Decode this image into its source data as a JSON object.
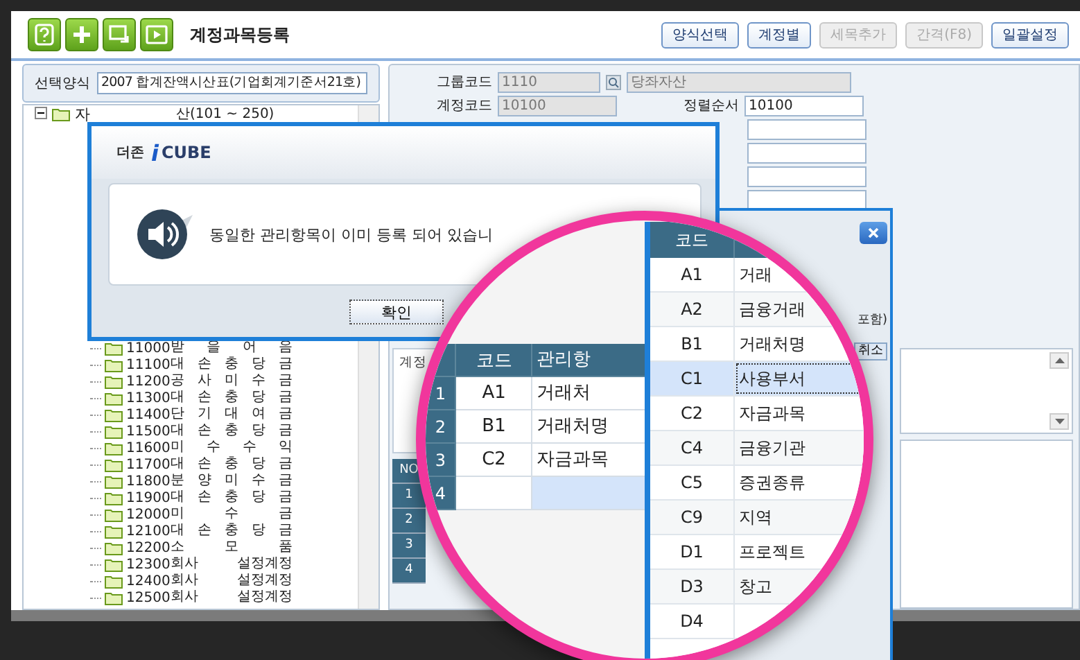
{
  "toolbar": {
    "title": "계정과목등록",
    "buttons": [
      {
        "label": "양식선택",
        "disabled": false
      },
      {
        "label": "계정별",
        "disabled": false
      },
      {
        "label": "세목추가",
        "disabled": true
      },
      {
        "label": "간격(F8)",
        "disabled": true
      },
      {
        "label": "일괄설정",
        "disabled": false
      }
    ]
  },
  "form_selector": {
    "label": "선택양식",
    "value": "2007 합계잔액시산표(기업회계기준서21호)"
  },
  "account_tree": {
    "code": "자",
    "name": "산(101 ~ 250)",
    "expanded": true,
    "children": [
      {
        "code": "11000",
        "name": "받 을 어 음"
      },
      {
        "code": "11100",
        "name": "대 손 충 당 금"
      },
      {
        "code": "11200",
        "name": "공 사 미 수 금"
      },
      {
        "code": "11300",
        "name": "대 손 충 당 금"
      },
      {
        "code": "11400",
        "name": "단 기 대 여 금"
      },
      {
        "code": "11500",
        "name": "대 손 충 당 금"
      },
      {
        "code": "11600",
        "name": "미 수 수 익"
      },
      {
        "code": "11700",
        "name": "대 손 충 당 금"
      },
      {
        "code": "11800",
        "name": "분 양 미 수 금"
      },
      {
        "code": "11900",
        "name": "대 손 충 당 금"
      },
      {
        "code": "12000",
        "name": "미 수 금"
      },
      {
        "code": "12100",
        "name": "대 손 충 당 금"
      },
      {
        "code": "12200",
        "name": "소 모 품"
      },
      {
        "code": "12300",
        "name": "회사 설정계정"
      },
      {
        "code": "12400",
        "name": "회사 설정계정"
      },
      {
        "code": "12500",
        "name": "회사 설정계정"
      }
    ]
  },
  "account_form": {
    "group_code_label": "그룹코드",
    "group_code": "1110",
    "group_name": "당좌자산",
    "account_code_label": "계정코드",
    "account_code": "10100",
    "sort_order_label": "정렬순서",
    "sort_order": "10100"
  },
  "item_label": "계정",
  "bottom_grid": {
    "header": "NO",
    "rows": [
      "1",
      "2",
      "3",
      "4"
    ]
  },
  "dialog": {
    "logo_maker": "더존",
    "logo_i": "i",
    "logo_brand": "CUBE",
    "message": "동일한 관리항목이 이미 등록 되어 있습니",
    "button": "확인"
  },
  "popup": {
    "option_text": "포함)",
    "cancel_button": "취소"
  },
  "magnifier": {
    "grid": {
      "code_header": "코드",
      "name_header": "관리항",
      "rows": [
        {
          "no": "1",
          "code": "A1",
          "name": "거래처",
          "selected": false
        },
        {
          "no": "2",
          "code": "B1",
          "name": "거래처명",
          "selected": false
        },
        {
          "no": "3",
          "code": "C2",
          "name": "자금과목",
          "selected": false
        },
        {
          "no": "4",
          "selected": true
        }
      ]
    },
    "code_list": {
      "header": "코드",
      "rows": [
        {
          "code": "A1",
          "name": "거래",
          "selected": false
        },
        {
          "code": "A2",
          "name": "금융거래",
          "selected": false
        },
        {
          "code": "B1",
          "name": "거래처명",
          "selected": false
        },
        {
          "code": "C1",
          "name": "사용부서",
          "selected": true
        },
        {
          "code": "C2",
          "name": "자금과목",
          "selected": false
        },
        {
          "code": "C4",
          "name": "금융기관",
          "selected": false
        },
        {
          "code": "C5",
          "name": "증권종류",
          "selected": false
        },
        {
          "code": "C9",
          "name": "지역",
          "selected": false
        },
        {
          "code": "D1",
          "name": "프로젝트",
          "selected": false
        },
        {
          "code": "D3",
          "name": "창고",
          "selected": false
        },
        {
          "code": "D4",
          "selected": false
        }
      ]
    }
  }
}
